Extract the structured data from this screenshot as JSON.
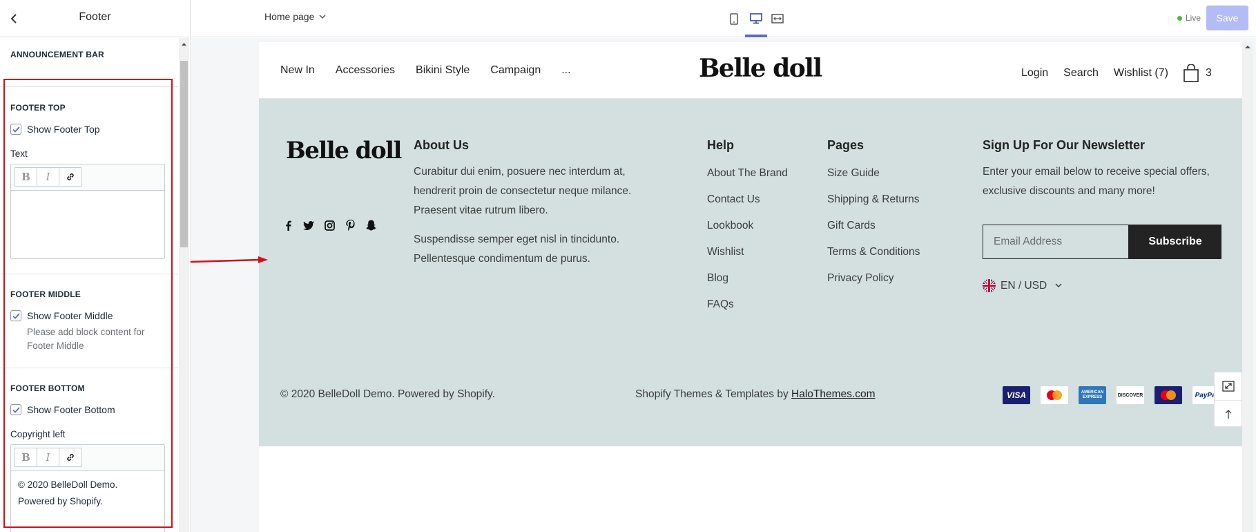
{
  "sidebar": {
    "title": "Footer",
    "announcement_title": "ANNOUNCEMENT BAR",
    "footer_top": {
      "title": "FOOTER TOP",
      "checkbox_label": "Show Footer Top",
      "checked": true,
      "text_label": "Text",
      "text_value": ""
    },
    "footer_middle": {
      "title": "FOOTER MIDDLE",
      "checkbox_label": "Show Footer Middle",
      "checked": true,
      "help": "Please add block content for Footer Middle"
    },
    "footer_bottom": {
      "title": "FOOTER BOTTOM",
      "checkbox_label": "Show Footer Bottom",
      "checked": true,
      "copyright_label": "Copyright left",
      "copyright_line1": "© 2020 BelleDoll Demo.",
      "copyright_line2": "Powered by Shopify."
    },
    "rte_buttons": [
      "B",
      "I"
    ]
  },
  "topbar": {
    "page_select": "Home page",
    "live_label": "Live",
    "save_label": "Save",
    "devices": [
      "mobile-icon",
      "desktop-icon",
      "fullscreen-icon"
    ],
    "active_device": "desktop-icon"
  },
  "store": {
    "logo": "Belle doll",
    "nav": [
      "New In",
      "Accessories",
      "Bikini Style",
      "Campaign",
      "..."
    ],
    "header_links": {
      "login": "Login",
      "search": "Search",
      "wishlist": "Wishlist (7)",
      "cart_count": "3"
    },
    "footer": {
      "background": "#d3e0df",
      "logo": "Belle doll",
      "socials": [
        "facebook-icon",
        "twitter-icon",
        "instagram-icon",
        "pinterest-icon",
        "snapchat-icon"
      ],
      "about": {
        "heading": "About Us",
        "para1_l1": "Curabitur dui enim, posuere nec interdum at,",
        "para1_l2": "hendrerit proin de consectetur neque milance.",
        "para1_l3": "Praesent vitae rutrum libero.",
        "para2_l1": "Suspendisse semper eget nisl in tinciduntо.",
        "para2_l2": "Pellentesque condimentum de purus."
      },
      "help": {
        "heading": "Help",
        "links": [
          "About The Brand",
          "Contact Us",
          "Lookbook",
          "Wishlist",
          "Blog",
          "FAQs"
        ]
      },
      "pages": {
        "heading": "Pages",
        "links": [
          "Size Guide",
          "Shipping & Returns",
          "Gift Cards",
          "Terms & Conditions",
          "Privacy Policy"
        ]
      },
      "newsletter": {
        "heading": "Sign Up For Our Newsletter",
        "text_l1": "Enter your email below to receive special offers,",
        "text_l2": "exclusive discounts and many more!",
        "placeholder": "Email Address",
        "button": "Subscribe"
      },
      "currency": "EN / USD",
      "copyright": "© 2020 BelleDoll Demo. Powered by Shopify.",
      "credit_prefix": "Shopify Themes & Templates by",
      "credit_link": "HaloThemes.com",
      "payments": [
        "VISA",
        "mastercard",
        "AMERICAN EXPRESS",
        "DISCOVER",
        "maestro",
        "PayPal"
      ]
    }
  }
}
